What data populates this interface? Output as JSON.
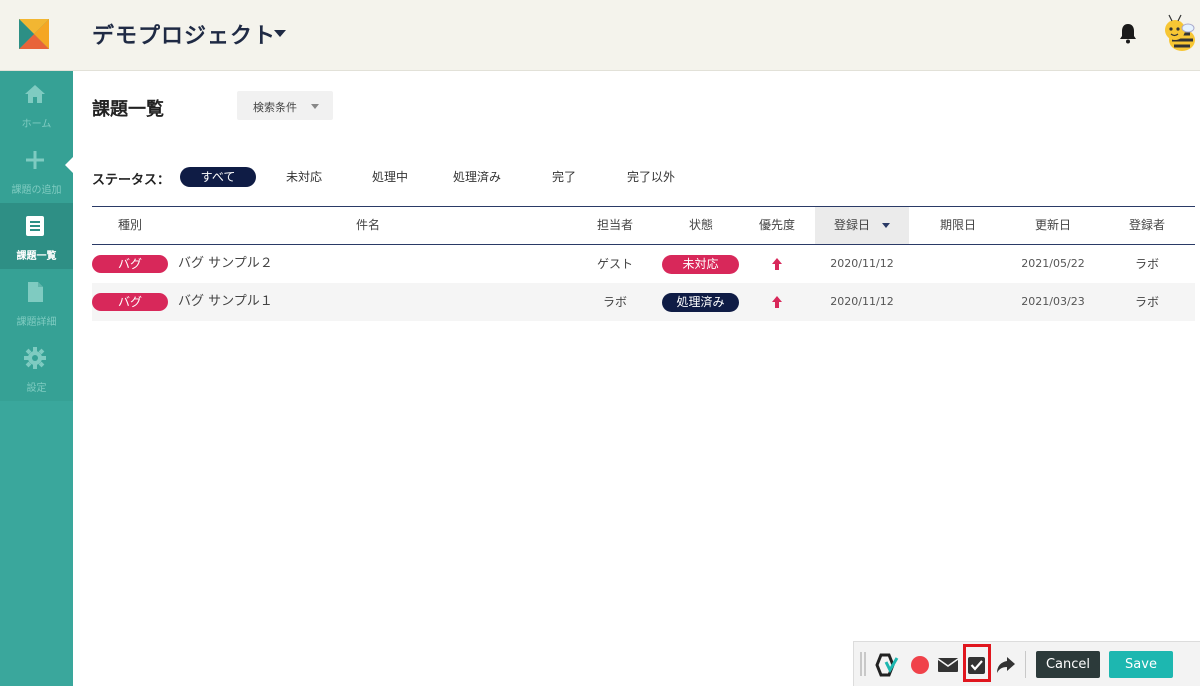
{
  "header": {
    "project_title": "デモプロジェクト",
    "icons": [
      "app-logo",
      "bell-icon",
      "bee-avatar"
    ]
  },
  "sidebar": {
    "items": [
      {
        "label": "ホーム",
        "icon": "home-icon",
        "active": false
      },
      {
        "label": "課題の追加",
        "icon": "plus-icon",
        "active": false
      },
      {
        "label": "課題一覧",
        "icon": "list-icon",
        "active": true
      },
      {
        "label": "課題詳細",
        "icon": "document-icon",
        "active": false
      },
      {
        "label": "設定",
        "icon": "gear-icon",
        "active": false
      }
    ]
  },
  "main": {
    "title": "課題一覧",
    "search_button": "検索条件",
    "status_label": "ステータス：",
    "status_filters": [
      {
        "label": "すべて",
        "active": true
      },
      {
        "label": "未対応",
        "active": false
      },
      {
        "label": "処理中",
        "active": false
      },
      {
        "label": "処理済み",
        "active": false
      },
      {
        "label": "完了",
        "active": false
      },
      {
        "label": "完了以外",
        "active": false
      }
    ],
    "table": {
      "columns": [
        "種別",
        "件名",
        "担当者",
        "状態",
        "優先度",
        "登録日",
        "期限日",
        "更新日",
        "登録者"
      ],
      "sorted_column": "登録日",
      "rows": [
        {
          "type": "バグ",
          "subject": "バグ サンプル２",
          "assignee": "ゲスト",
          "status": "未対応",
          "status_color": "#d8285a",
          "priority": "high-priority-arrow-icon",
          "created": "2020/11/12",
          "due": "",
          "updated": "2021/05/22",
          "reporter": "ラボ"
        },
        {
          "type": "バグ",
          "subject": "バグ サンプル１",
          "assignee": "ラボ",
          "status": "処理済み",
          "status_color": "#0f1c45",
          "priority": "high-priority-arrow-icon",
          "created": "2020/11/12",
          "due": "",
          "updated": "2021/03/23",
          "reporter": "ラボ"
        }
      ]
    }
  },
  "toolbar": {
    "icons": [
      "app-logo-icon",
      "record-icon",
      "mail-icon",
      "checkbox-icon",
      "share-icon"
    ],
    "cancel_label": "Cancel",
    "save_label": "Save"
  },
  "colors": {
    "sidebar": "#3aa79c",
    "accent_navy": "#0f1c45",
    "accent_red": "#d8285a",
    "save": "#1db7b0"
  }
}
